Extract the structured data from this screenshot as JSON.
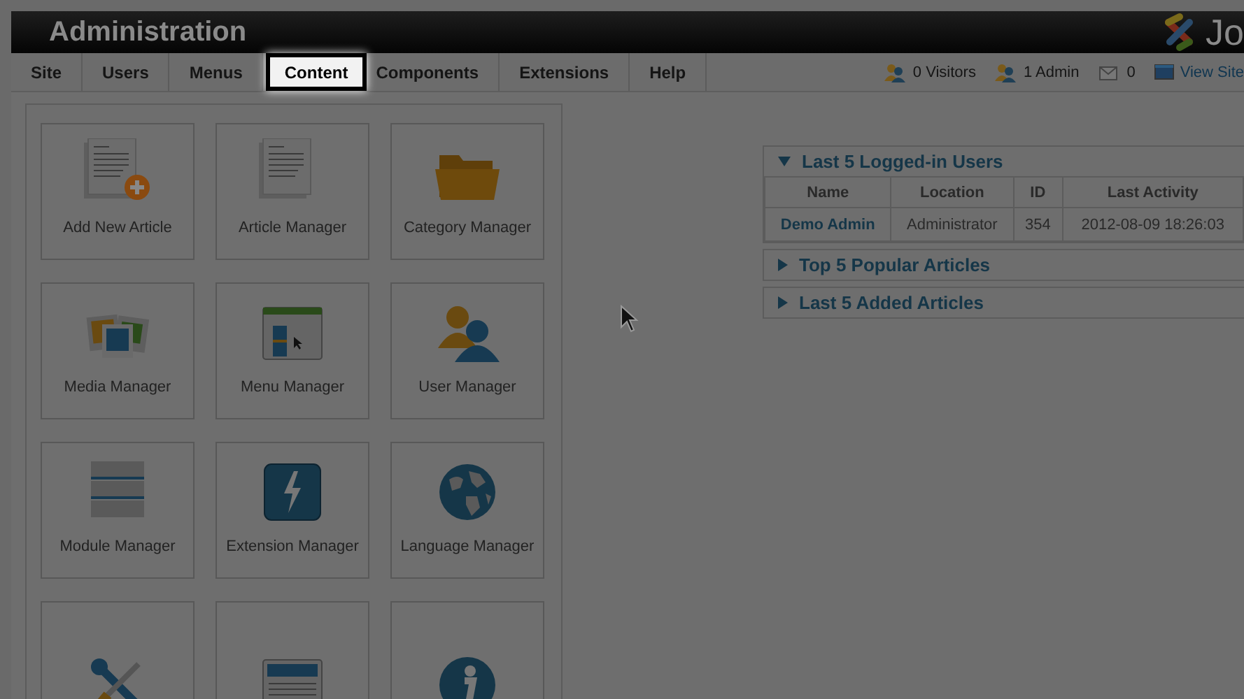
{
  "header": {
    "title": "Administration",
    "logo_text": "Jo"
  },
  "menu": [
    {
      "label": "Site",
      "highlighted": false
    },
    {
      "label": "Users",
      "highlighted": false
    },
    {
      "label": "Menus",
      "highlighted": false
    },
    {
      "label": "Content",
      "highlighted": true
    },
    {
      "label": "Components",
      "highlighted": false
    },
    {
      "label": "Extensions",
      "highlighted": false
    },
    {
      "label": "Help",
      "highlighted": false
    }
  ],
  "status": [
    {
      "kind": "visitors",
      "text": "0 Visitors"
    },
    {
      "kind": "admins",
      "text": "1 Admin"
    },
    {
      "kind": "messages",
      "text": "0"
    },
    {
      "kind": "link",
      "text": "View Site"
    }
  ],
  "cards": [
    {
      "kind": "labeled",
      "label": "Add New Article"
    },
    {
      "kind": "labeled",
      "label": "Article Manager"
    },
    {
      "kind": "labeled",
      "label": "Category Manager"
    },
    {
      "kind": "labeled",
      "label": "Media Manager"
    },
    {
      "kind": "labeled",
      "label": "Menu Manager"
    },
    {
      "kind": "labeled",
      "label": "User Manager"
    },
    {
      "kind": "labeled",
      "label": "Module Manager"
    },
    {
      "kind": "labeled",
      "label": "Extension Manager"
    },
    {
      "kind": "labeled",
      "label": "Language Manager"
    },
    {
      "kind": "cut-off"
    },
    {
      "kind": "cut-off"
    },
    {
      "kind": "cut-off"
    }
  ],
  "panels": [
    {
      "title": "Last 5 Logged-in Users",
      "expanded": true,
      "table": {
        "columns": [
          "Name",
          "Location",
          "ID",
          "Last Activity"
        ],
        "rows": [
          [
            "Demo Admin",
            "Administrator",
            "354",
            "2012-08-09 18:26:03"
          ]
        ]
      }
    },
    {
      "title": "Top 5 Popular Articles",
      "expanded": false
    },
    {
      "title": "Last 5 Added Articles",
      "expanded": false
    }
  ]
}
